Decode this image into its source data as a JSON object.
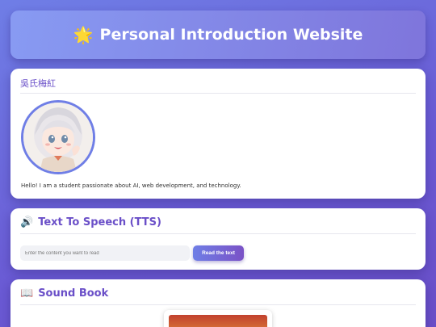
{
  "header": {
    "icon": "star-icon",
    "star_glyph": "🌟",
    "title": "Personal Introduction Website"
  },
  "profile": {
    "name": "吳氏梅紅",
    "bio": "Hello! I am a student passionate about AI, web development, and technology."
  },
  "tts": {
    "icon": "speaker-icon",
    "icon_glyph": "🔊",
    "title": "Text To Speech (TTS)",
    "placeholder": "Enter the content you want to read",
    "button": "Read the text"
  },
  "sound_book": {
    "icon": "book-icon",
    "icon_glyph": "📖",
    "title": "Sound Book"
  },
  "colors": {
    "accent": "#6a4fc8",
    "gradient_start": "#6f7ee6",
    "card": "#ffffff"
  }
}
